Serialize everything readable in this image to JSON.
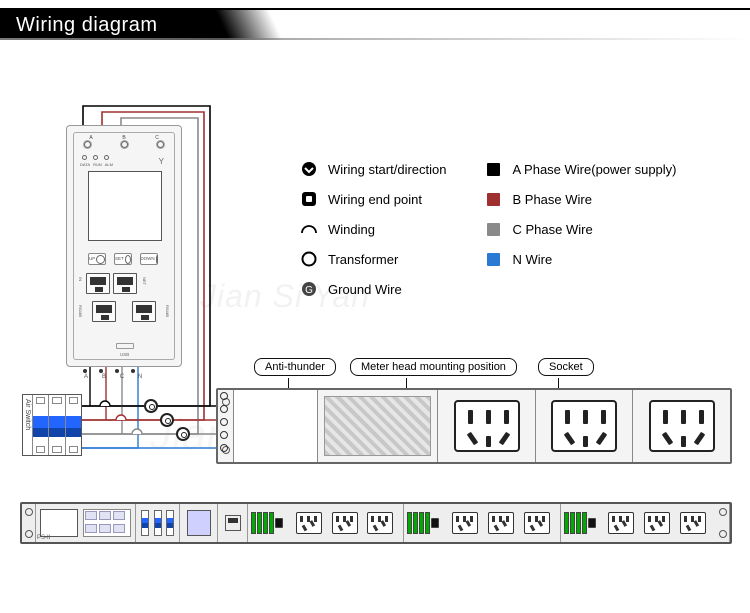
{
  "title": "Wiring diagram",
  "legend": {
    "col1": [
      {
        "label": "Wiring start/direction"
      },
      {
        "label": "Wiring end point"
      },
      {
        "label": "Winding"
      },
      {
        "label": "Transformer"
      },
      {
        "label": "Ground Wire"
      }
    ],
    "col2": [
      {
        "label": "A Phase Wire(power supply)",
        "color": "#000000"
      },
      {
        "label": "B Phase Wire",
        "color": "#a03030"
      },
      {
        "label": "C Phase Wire",
        "color": "#8a8a8a"
      },
      {
        "label": "N Wire",
        "color": "#2a7ad4"
      }
    ]
  },
  "meter": {
    "top_ports": [
      "A",
      "B",
      "C"
    ],
    "top_dots2": [
      "DATA",
      "RUN",
      "ALM"
    ],
    "buttons": [
      "UP",
      "SET",
      "DOWN"
    ],
    "rj_top": [
      "IN",
      "NET"
    ],
    "rj_bottom": [
      "RS485",
      "RS485"
    ],
    "usb": "USB",
    "bottom_terminals": [
      "A",
      "B",
      "C",
      "N"
    ]
  },
  "callouts": {
    "anti": "Anti-thunder",
    "meter_head": "Meter head mounting position",
    "socket": "Socket"
  },
  "air_switch": "Air Switch",
  "wire_colors": {
    "A": "#000000",
    "B": "#a03030",
    "C": "#8a8a8a",
    "N": "#2a7ad4"
  },
  "mini_pdu": {
    "id_label": "PS-II",
    "outlet_groups": 3,
    "outlets_per_group": 3,
    "breaker_poles": 4
  },
  "watermark": "Jian Si Yan"
}
